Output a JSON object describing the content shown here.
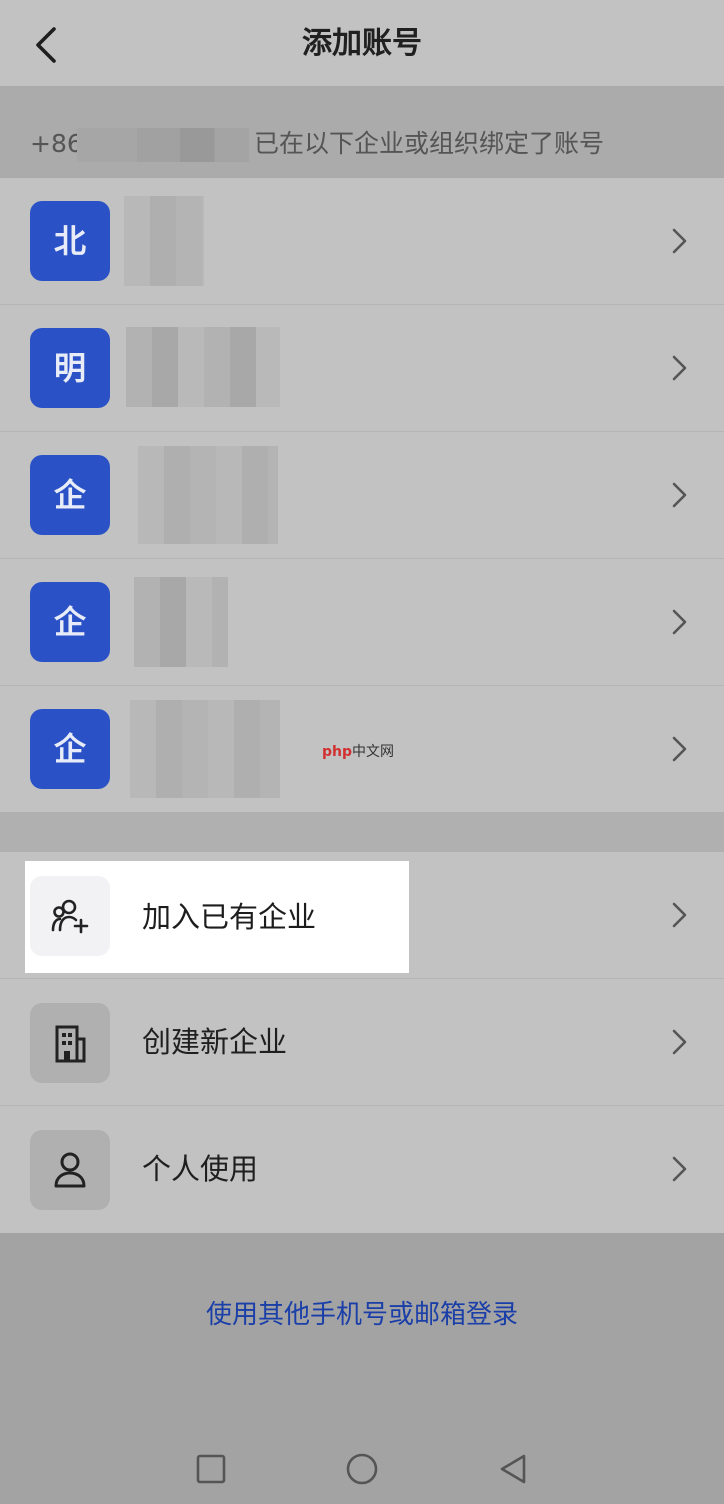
{
  "header": {
    "title": "添加账号"
  },
  "phone": {
    "prefix": "+86",
    "suffix": "已在以下企业或组织绑定了账号"
  },
  "orgs": [
    {
      "avatar": "北"
    },
    {
      "avatar": "明"
    },
    {
      "avatar": "企"
    },
    {
      "avatar": "企"
    },
    {
      "avatar": "企"
    }
  ],
  "actions": [
    {
      "label": "加入已有企业",
      "icon": "add-user-icon"
    },
    {
      "label": "创建新企业",
      "icon": "building-icon"
    },
    {
      "label": "个人使用",
      "icon": "person-icon"
    }
  ],
  "alt_login": "使用其他手机号或邮箱登录",
  "watermark": {
    "brand": "php",
    "site": "中文网"
  },
  "colors": {
    "accent": "#2a52c6",
    "link": "#1b3fa8"
  }
}
